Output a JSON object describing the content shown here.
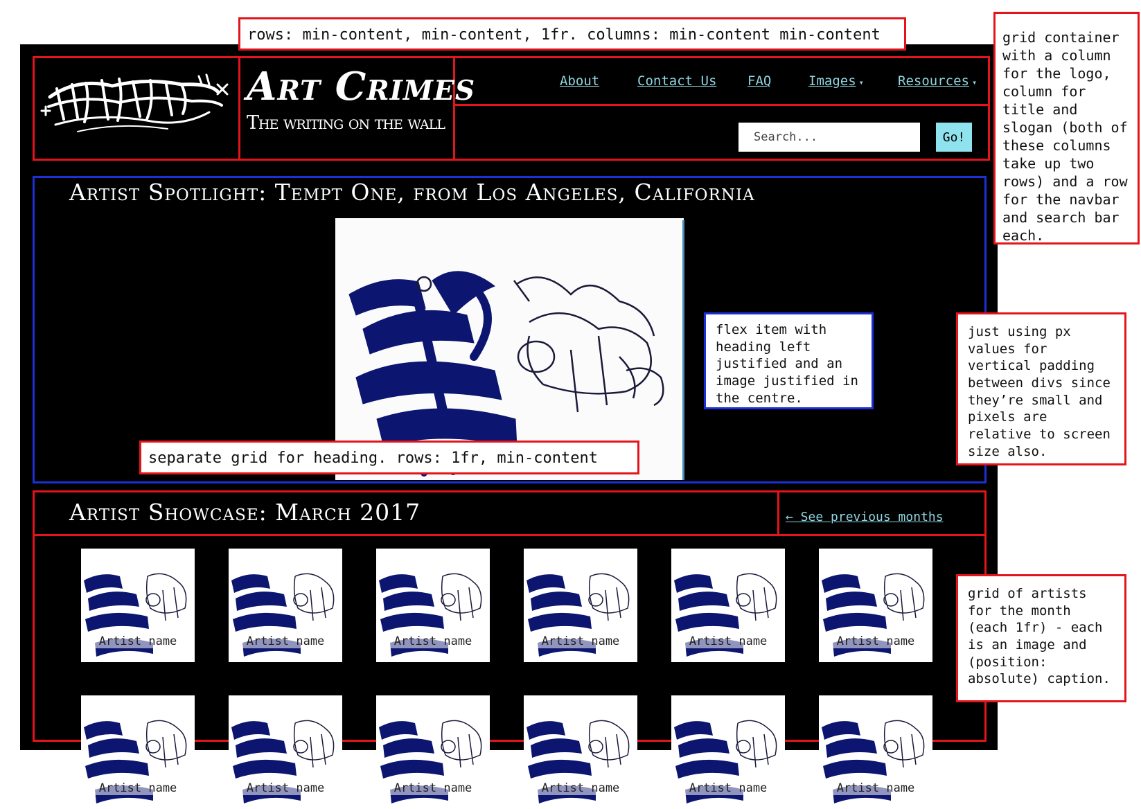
{
  "site": {
    "title": "Art Crimes",
    "slogan": "The writing on the wall",
    "logo_alt": "Art Crimes"
  },
  "nav": {
    "items": [
      {
        "label": "About"
      },
      {
        "label": "Contact Us"
      },
      {
        "label": "FAQ"
      },
      {
        "label": "Images",
        "caret": "▾"
      },
      {
        "label": "Resources",
        "caret": "▾"
      }
    ]
  },
  "search": {
    "placeholder": "Search...",
    "button_label": "Go!"
  },
  "spotlight": {
    "heading": "Artist Spotlight: Tempt One, from Los Angeles, California"
  },
  "showcase": {
    "heading": "Artist Showcase: March 2017",
    "previous_link": "← See previous months",
    "artists": [
      {
        "caption": "Artist name"
      },
      {
        "caption": "Artist name"
      },
      {
        "caption": "Artist name"
      },
      {
        "caption": "Artist name"
      },
      {
        "caption": "Artist name"
      },
      {
        "caption": "Artist name"
      }
    ]
  },
  "annotations": {
    "top_grid": "rows: min-content, min-content, 1fr. columns: min-content min-content",
    "grid_container": "grid container with a column for the logo, column for title and slogan (both of these columns take up two rows) and a row for the navbar and search bar each.",
    "flex_item": "flex item with heading left justified and an image justified in the centre.",
    "padding": "just using px values for vertical padding between divs since they’re small and pixels are relative to screen size also.",
    "heading_grid": "separate grid for heading. rows: 1fr, min-content",
    "artists_grid": "grid of artists for the month (each 1fr) - each is an image and (position: absolute) caption."
  },
  "colors": {
    "background": "#000000",
    "annotation_red": "#e3141b",
    "annotation_blue": "#1d2fd6",
    "link": "#8fd6e1",
    "go_button": "#8fe3ee"
  }
}
